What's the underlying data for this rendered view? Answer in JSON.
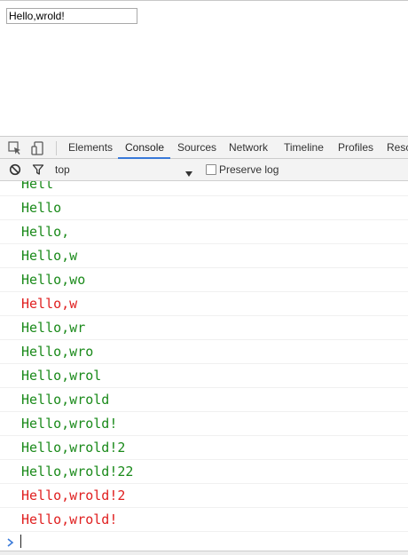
{
  "page": {
    "input_value": "Hello,wrold!"
  },
  "devtools": {
    "icons": {
      "inspect": "inspect-element-icon",
      "device": "device-mode-icon"
    },
    "tabs": [
      {
        "label": "Elements",
        "active": false
      },
      {
        "label": "Console",
        "active": true
      },
      {
        "label": "Sources",
        "active": false
      },
      {
        "label": "Network",
        "active": false
      },
      {
        "label": "Timeline",
        "active": false
      },
      {
        "label": "Profiles",
        "active": false
      },
      {
        "label": "Resc",
        "active": false
      }
    ],
    "filter_bar": {
      "clear_icon": "clear-console-icon",
      "filter_icon": "filter-icon",
      "context": "top",
      "preserve_log_label": "Preserve log",
      "preserve_log_checked": false
    },
    "accent_color": "#3879d9"
  },
  "console": {
    "lines": [
      {
        "text": "Hell",
        "color": "green"
      },
      {
        "text": "Hello",
        "color": "green"
      },
      {
        "text": "Hello,",
        "color": "green"
      },
      {
        "text": "Hello,w",
        "color": "green"
      },
      {
        "text": "Hello,wo",
        "color": "green"
      },
      {
        "text": "Hello,w",
        "color": "red"
      },
      {
        "text": "Hello,wr",
        "color": "green"
      },
      {
        "text": "Hello,wro",
        "color": "green"
      },
      {
        "text": "Hello,wrol",
        "color": "green"
      },
      {
        "text": "Hello,wrold",
        "color": "green"
      },
      {
        "text": "Hello,wrold!",
        "color": "green"
      },
      {
        "text": "Hello,wrold!2",
        "color": "green"
      },
      {
        "text": "Hello,wrold!22",
        "color": "green"
      },
      {
        "text": "Hello,wrold!2",
        "color": "red"
      },
      {
        "text": "Hello,wrold!",
        "color": "red"
      }
    ],
    "prompt_icon": "prompt-chevron-icon",
    "colors": {
      "green": "#1a8a1a",
      "red": "#e02020"
    }
  }
}
